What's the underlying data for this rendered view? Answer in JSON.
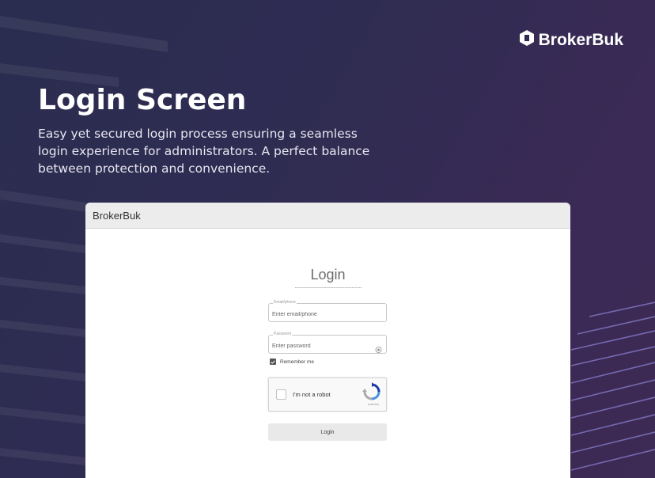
{
  "brand": {
    "name": "BrokerBuk",
    "icon": "brokerbuk-logo-icon"
  },
  "hero": {
    "title": "Login Screen",
    "description": "Easy yet secured login process ensuring a seamless login experience for administrators. A perfect balance between protection and convenience."
  },
  "window": {
    "title": "BrokerBuk",
    "form": {
      "title": "Login",
      "email": {
        "label": "Email/phone",
        "placeholder": "Enter email/phone",
        "value": ""
      },
      "password": {
        "label": "Password",
        "placeholder": "Enter password",
        "value": "",
        "icon": "eye-icon"
      },
      "remember": {
        "label": "Remember me",
        "checked": true
      },
      "captcha": {
        "label": "I'm not a robot",
        "privacy": "reCAPTCHA",
        "icon": "recaptcha-icon"
      },
      "login_button": "Login"
    }
  },
  "colors": {
    "background": "#2f2c52",
    "accent": "#7a6fc8",
    "panel": "#ffffff",
    "button": "#e9e9e9"
  }
}
